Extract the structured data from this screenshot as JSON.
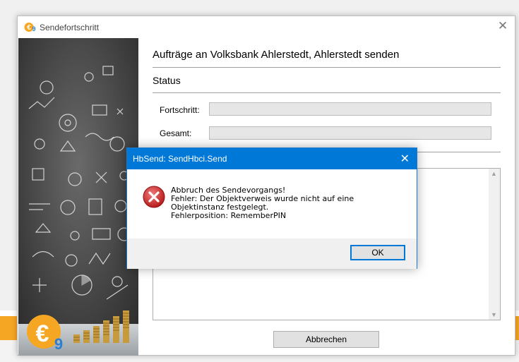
{
  "window": {
    "title": "Sendefortschritt",
    "heading": "Aufträge an Volksbank Ahlerstedt, Ahlerstedt senden",
    "status_label": "Status",
    "fortschritt_label": "Fortschritt:",
    "gesamt_label": "Gesamt:",
    "cancel_label": "Abbrechen",
    "progress_fortschritt": 0,
    "progress_gesamt": 0
  },
  "dialog": {
    "title": "HbSend: SendHbci.Send",
    "line1": "Abbruch des Sendevorgangs!",
    "line2": "Fehler: Der Objektverweis wurde nicht auf eine Objektinstanz festgelegt.",
    "line3": "Fehlerposition: RememberPIN",
    "ok_label": "OK"
  },
  "colors": {
    "accent": "#0078d7",
    "brand_orange": "#f5a623",
    "error_red": "#d32f2f"
  },
  "icons": {
    "app": "euro-9-logo-icon",
    "error": "error-x-icon",
    "close": "close-icon"
  }
}
